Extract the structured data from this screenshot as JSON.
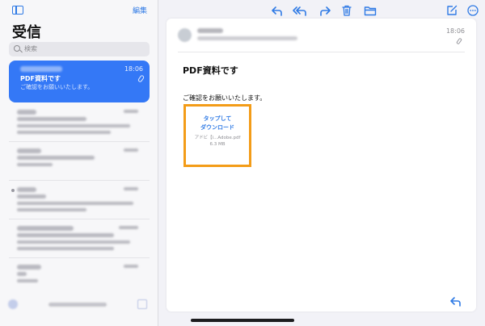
{
  "sidebar": {
    "edit_label": "編集",
    "title": "受信",
    "search_placeholder": "検索",
    "selected_message": {
      "time": "18:06",
      "subject": "PDF資料です",
      "preview": "ご確認をお願いいたします。"
    }
  },
  "message": {
    "time": "18:06",
    "subject": "PDF資料です",
    "body": "ご確認をお願いいたします。",
    "attachment": {
      "action_line1": "タップして",
      "action_line2": "ダウンロード",
      "filename": "アドビ【i...Adobe.pdf",
      "size": "6.3 MB"
    }
  },
  "colors": {
    "accent": "#2f7ae5",
    "selection": "#3478f6",
    "highlight_border": "#f39c18"
  },
  "icons": [
    "sidebar-toggle-icon",
    "search-icon",
    "paperclip-icon",
    "reply-icon",
    "reply-all-icon",
    "forward-icon",
    "trash-icon",
    "folder-icon",
    "compose-icon",
    "more-icon"
  ]
}
